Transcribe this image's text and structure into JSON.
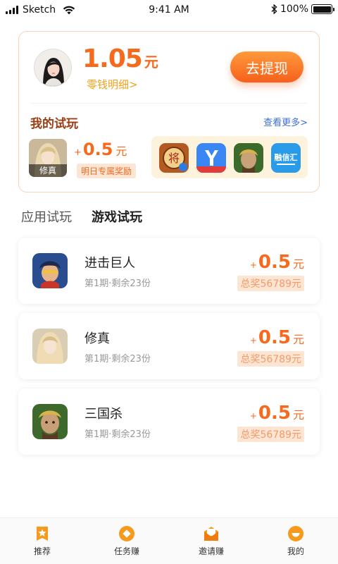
{
  "status_bar": {
    "carrier": "Sketch",
    "time": "9:41 AM",
    "battery": "100%"
  },
  "wallet": {
    "balance": "1.05",
    "unit": "元",
    "detail_link": "零钱明细>",
    "withdraw_label": "去提现"
  },
  "my_trial": {
    "title": "我的试玩",
    "see_more": "查看更多>",
    "current_game": "修真",
    "reward_plus": "+",
    "reward_amount": "0.5",
    "reward_unit": "元",
    "reward_tag": "明日专属奖励",
    "strip_apps": [
      "chess-app-icon",
      "blue-app-icon",
      "warrior-app-icon",
      "finance-app-icon"
    ]
  },
  "tabs": [
    {
      "label": "应用试玩",
      "active": false
    },
    {
      "label": "游戏试玩",
      "active": true
    }
  ],
  "games": [
    {
      "name": "进击巨人",
      "sub": "第1期·剩余23份",
      "plus": "+",
      "amount": "0.5",
      "unit": "元",
      "pool": "总奖56789元"
    },
    {
      "name": "修真",
      "sub": "第1期·剩余23份",
      "plus": "+",
      "amount": "0.5",
      "unit": "元",
      "pool": "总奖56789元"
    },
    {
      "name": "三国杀",
      "sub": "第1期·剩余23份",
      "plus": "+",
      "amount": "0.5",
      "unit": "元",
      "pool": "总奖56789元"
    }
  ],
  "bottom_nav": [
    {
      "label": "推荐",
      "icon": "star-icon"
    },
    {
      "label": "任务赚",
      "icon": "coin-icon"
    },
    {
      "label": "邀请赚",
      "icon": "invite-envelope-icon"
    },
    {
      "label": "我的",
      "icon": "profile-icon"
    }
  ],
  "colors": {
    "accent": "#f56a1c",
    "gold": "#f0a21c",
    "brown": "#9b3d12",
    "link": "#3b6fd8",
    "nav_icon": "#f59a1c"
  }
}
